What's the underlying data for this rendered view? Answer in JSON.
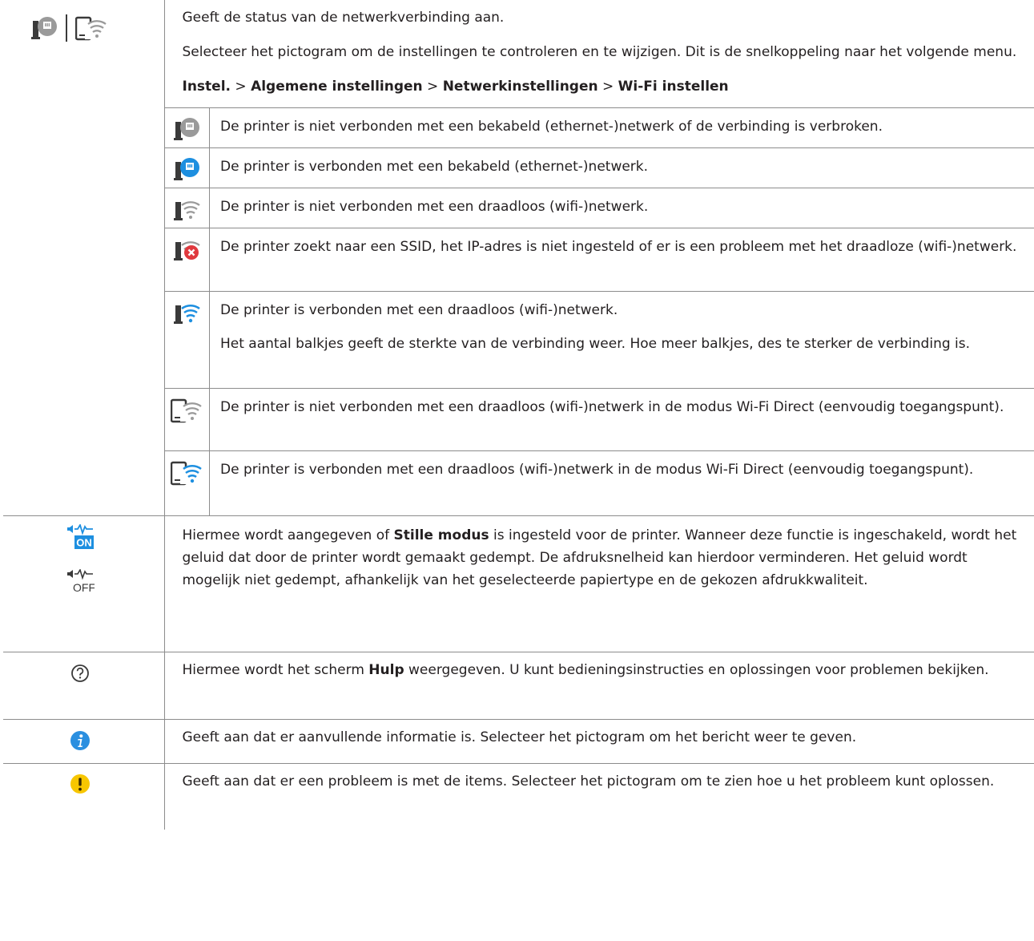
{
  "rows": [
    {
      "description": "Geeft de status van de netwerkverbinding aan.",
      "instruction": "Selecteer het pictogram om de instellingen te controleren en te wijzigen. Dit is de snelkoppeling naar het volgende menu.",
      "path": {
        "item1": "Instel.",
        "sep": ">",
        "item2": "Algemene instellingen",
        "item3": "Netwerkinstellingen",
        "item4": "Wi-Fi instellen"
      },
      "sub_rows": [
        {
          "icon": "ethernet-disconnected-icon",
          "text": "De printer is niet verbonden met een bekabeld (ethernet-)netwerk of de verbinding is verbroken."
        },
        {
          "icon": "ethernet-connected-icon",
          "text": "De printer is verbonden met een bekabeld (ethernet-)netwerk."
        },
        {
          "icon": "wifi-disconnected-icon",
          "text": "De printer is niet verbonden met een draadloos (wifi-)netwerk."
        },
        {
          "icon": "wifi-error-icon",
          "text": "De printer zoekt naar een SSID, het IP-adres is niet ingesteld of er is een probleem met het draadloze (wifi-)netwerk."
        },
        {
          "icon": "wifi-connected-icon",
          "text": "De printer is verbonden met een draadloos (wifi-)netwerk.",
          "text2": "Het aantal balkjes geeft de sterkte van de verbinding weer. Hoe meer balkjes, des te sterker de verbinding is."
        },
        {
          "icon": "wifi-direct-disconnected-icon",
          "text": "De printer is niet verbonden met een draadloos (wifi-)netwerk in de modus Wi-Fi Direct (eenvoudig toegangspunt)."
        },
        {
          "icon": "wifi-direct-connected-icon",
          "text": "De printer is verbonden met een draadloos (wifi-)netwerk in de modus Wi-Fi Direct (eenvoudig toegangspunt)."
        }
      ]
    },
    {
      "text_before": "Hiermee wordt aangegeven of ",
      "text_bold": "Stille modus",
      "text_after": " is ingesteld voor de printer. Wanneer deze functie is ingeschakeld, wordt het geluid dat door de printer wordt gemaakt gedempt. De afdruksnelheid kan hierdoor verminderen. Het geluid wordt mogelijk niet gedempt, afhankelijk van het geselecteerde papiertype en de gekozen afdrukkwaliteit.",
      "icon_on_label": "ON",
      "icon_off_label": "OFF"
    },
    {
      "text_before": "Hiermee wordt het scherm ",
      "text_bold": "Hulp",
      "text_after": " weergegeven. U kunt bedieningsinstructies en oplossingen voor problemen bekijken."
    },
    {
      "text": "Geeft aan dat er aanvullende informatie is. Selecteer het pictogram om het bericht weer te geven."
    },
    {
      "text": "Geeft aan dat er een probleem is met de items. Selecteer het pictogram om te zien hoe u het probleem kunt oplossen."
    }
  ],
  "colors": {
    "border": "#8c8c8c",
    "icon_gray": "#9a9a9a",
    "icon_dark": "#3a3a3a",
    "icon_blue": "#1d8fe0",
    "error_red": "#e0393e",
    "info_blue": "#2a8fe0",
    "warning_yellow": "#f7c600"
  }
}
